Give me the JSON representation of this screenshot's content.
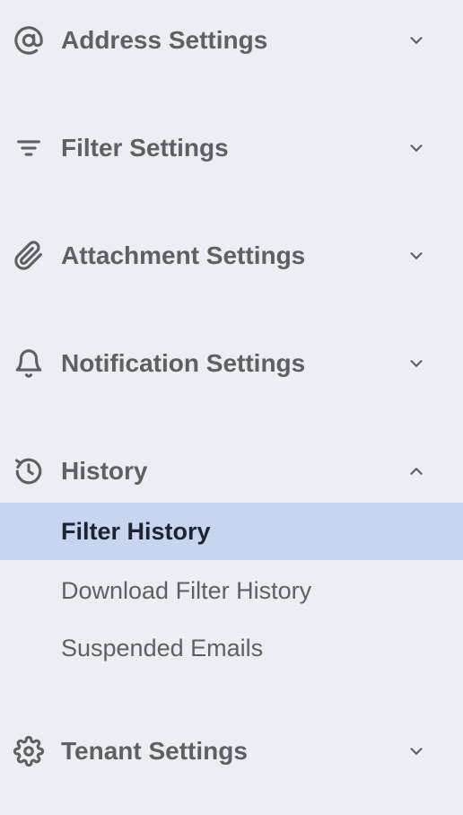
{
  "nav": {
    "sections": [
      {
        "label": "Address Settings",
        "icon": "at-sign-icon",
        "expanded": false
      },
      {
        "label": "Filter Settings",
        "icon": "filter-lines-icon",
        "expanded": false
      },
      {
        "label": "Attachment Settings",
        "icon": "paperclip-icon",
        "expanded": false
      },
      {
        "label": "Notification Settings",
        "icon": "bell-icon",
        "expanded": false
      },
      {
        "label": "History",
        "icon": "history-icon",
        "expanded": true,
        "items": [
          {
            "label": "Filter History",
            "active": true
          },
          {
            "label": "Download Filter History",
            "active": false
          },
          {
            "label": "Suspended Emails",
            "active": false
          }
        ]
      },
      {
        "label": "Tenant Settings",
        "icon": "gear-icon",
        "expanded": false
      }
    ]
  },
  "colors": {
    "background": "#eceef3",
    "text": "#5b6069",
    "active_background": "#c8d5f1",
    "active_text": "#1d2330"
  }
}
